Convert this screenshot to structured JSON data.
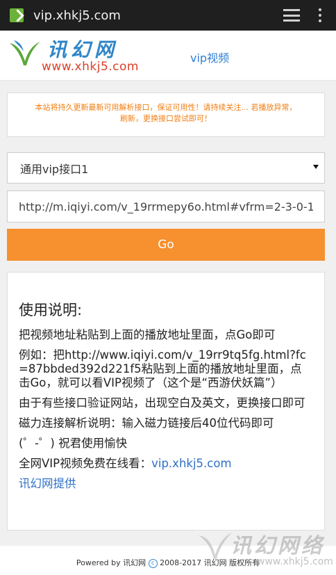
{
  "browser": {
    "url": "vip.xhkj5.com"
  },
  "header": {
    "logo_cn": "讯幻网",
    "logo_domain": "www.xhkj5.com",
    "nav_vip": "vip视频"
  },
  "notice": {
    "line1": "本站将持久更新最新可用解析接口，保证可用性！请持续关注... 若播放异常，",
    "line2": "刷新，更换接口尝试即可！"
  },
  "form": {
    "selected_api": "通用vip接口1",
    "url_value": "http://m.iqiyi.com/v_19rrmepy6o.html#vfrm=2-3-0-1",
    "go_label": "Go"
  },
  "instructions": {
    "title": "使用说明:",
    "p1": "把视频地址粘贴到上面的播放地址里面，点Go即可",
    "p2": "例如：把http://www.iqiyi.com/v_19rr9tq5fg.html?fc=87bbded392d221f5粘贴到上面的播放地址里面，点击Go，就可以看VIP视频了（这个是“西游伏妖篇”）",
    "p3": "由于有些接口验证网站，出现空白及英文，更换接口即可",
    "p4": "磁力连接解析说明：输入磁力链接后40位代码即可",
    "p5": "(゜-゜) 祝君使用愉快",
    "p6_prefix": "全网VIP视频免费在线看：",
    "p6_link": "vip.xhkj5.com",
    "p7_link": "讯幻网提供"
  },
  "footer": {
    "powered": "Powered by 讯幻网",
    "copyright": "2008-2017 讯幻网 版权所有"
  },
  "watermark": {
    "cn": "讯幻网络",
    "domain": "www.xhkj5.com"
  },
  "colors": {
    "accent_orange": "#f7902f",
    "link_blue": "#2f7fd4",
    "notice_orange": "#f07e12"
  }
}
